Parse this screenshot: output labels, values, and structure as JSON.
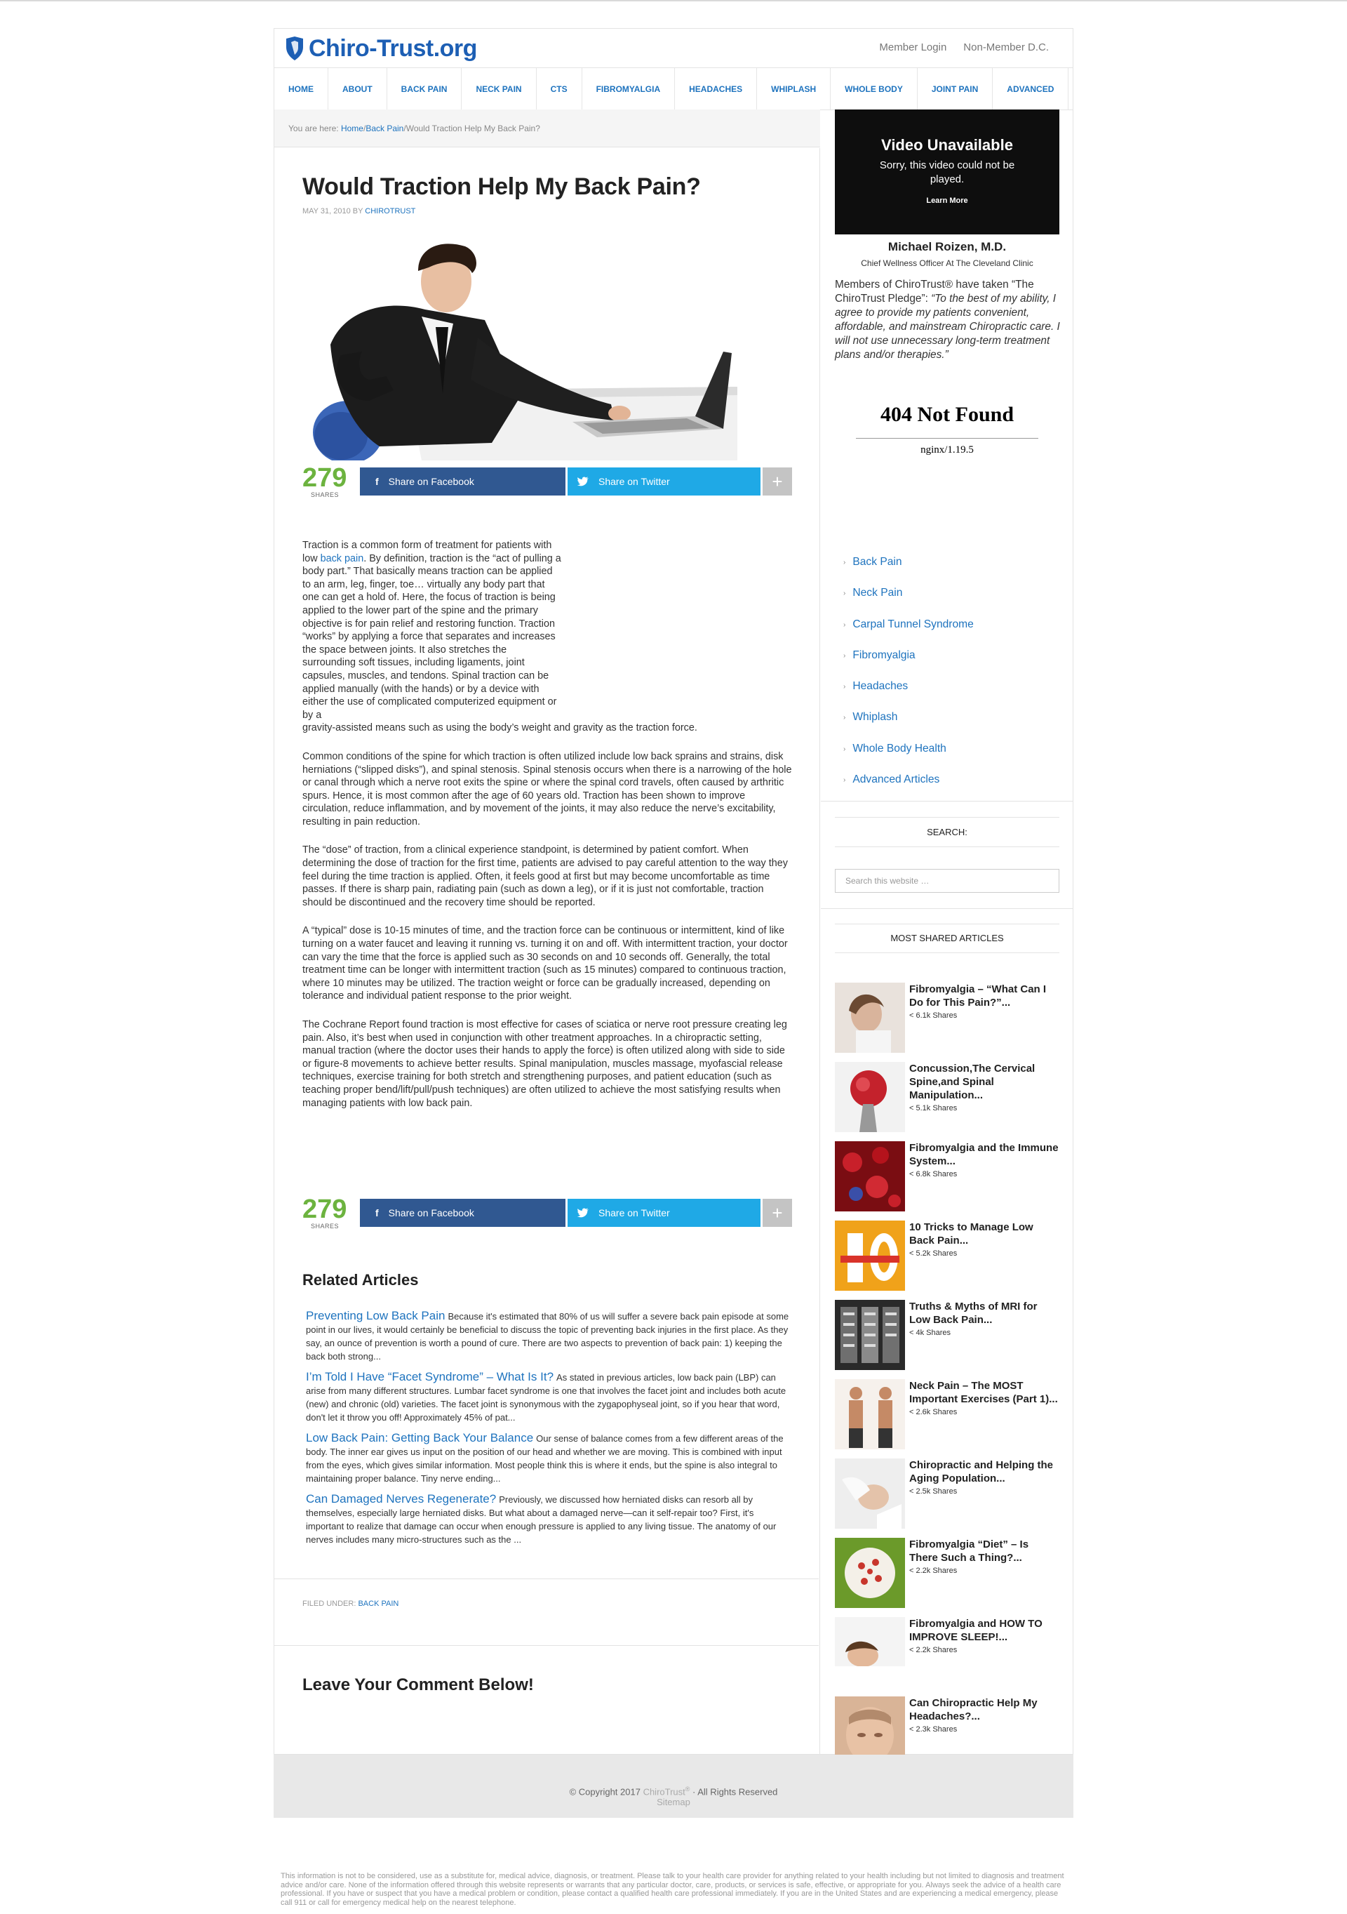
{
  "site": {
    "logo_text": "Chiro-Trust.org",
    "header_links": [
      "Member Login",
      "Non-Member D.C."
    ],
    "nav": [
      "HOME",
      "ABOUT",
      "BACK PAIN",
      "NECK PAIN",
      "CTS",
      "FIBROMYALGIA",
      "HEADACHES",
      "WHIPLASH",
      "WHOLE BODY",
      "JOINT PAIN",
      "ADVANCED"
    ]
  },
  "breadcrumb": {
    "prefix": "You are here: ",
    "home": "Home",
    "sep1": " / ",
    "section": "Back Pain",
    "sep2": " / ",
    "current": "Would Traction Help My Back Pain?"
  },
  "article": {
    "title": "Would Traction Help My Back Pain?",
    "date": "MAY 31, 2010",
    "by": " BY ",
    "author": "CHIROTRUST",
    "share_count": "279",
    "share_label": "SHARES",
    "share_facebook": "Share on Facebook",
    "share_twitter": "Share on Twitter",
    "share_more": "+",
    "p1_before": "Traction is a common form of treatment for patients with low ",
    "p1_link": "back pain",
    "p1_after": ". By definition, traction is the “act of pulling a body part.” That basically means traction can be applied to an arm, leg, finger, toe… virtually any body part that one can get a hold of. Here, the focus of traction is being applied to the lower part of the spine and the primary objective is for pain relief and restoring function. Traction “works” by applying a force that separates and increases the space between joints. It also stretches the surrounding soft tissues, including ligaments, joint capsules, muscles, and tendons. Spinal traction can be applied manually (with the hands) or by a device with either the use of complicated computerized equipment or by a",
    "p1_tail": "gravity-assisted means such as using the body’s weight and gravity as the traction force.",
    "p2": "Common conditions of the spine for which traction is often utilized include low back sprains and strains, disk herniations (“slipped disks”), and spinal stenosis. Spinal stenosis occurs when there is a narrowing of the hole or canal through which a nerve root exits the spine or where the spinal cord travels, often caused by arthritic spurs. Hence, it is most common after the age of 60 years old. Traction has been shown to improve circulation, reduce inflammation, and by movement of the joints, it may also reduce the nerve’s excitability, resulting in pain reduction.",
    "p3": "The “dose” of traction, from a clinical experience standpoint, is determined by patient comfort. When determining the dose of traction for the first time, patients are advised to pay careful attention to the way they feel during the time traction is applied. Often, it feels good at first but may become uncomfortable as time passes. If there is sharp pain, radiating pain (such as down a leg), or if it is just not comfortable, traction should be discontinued and the recovery time should be reported.",
    "p4": "A “typical” dose is 10-15 minutes of time, and the traction force can be continuous or intermittent, kind of like turning on a water faucet and leaving it running vs. turning it on and off. With intermittent traction, your doctor can vary the time that the force is applied such as 30 seconds on and 10 seconds off. Generally, the total treatment time can be longer with intermittent traction (such as 15 minutes) compared to continuous traction, where 10 minutes may be utilized. The traction weight or force can be gradually increased, depending on tolerance and individual patient response to the prior weight.",
    "p5": "The Cochrane Report found traction is most effective for cases of sciatica or nerve root pressure creating leg pain. Also, it’s best when used in conjunction with other treatment approaches. In a chiropractic setting, manual traction (where the doctor uses their hands to apply the force) is often utilized along with side to side or figure-8 movements to achieve better results. Spinal manipulation, muscles massage, myofascial release techniques, exercise training for both stretch and strengthening purposes, and patient education (such as teaching proper bend/lift/pull/push techniques) are often utilized to achieve the most satisfying results when managing patients with low back pain.",
    "related_title": "Related Articles",
    "related": [
      {
        "title": "Preventing Low Back Pain",
        "excerpt": "Because it's estimated that 80% of us will suffer a severe back pain episode at some point in our lives, it would certainly be beneficial to discuss the topic of preventing back injuries in the first place. As they say, an ounce of prevention is worth a pound of cure. There are two aspects to prevention of back pain: 1) keeping the back both strong..."
      },
      {
        "title": "I’m Told I Have “Facet Syndrome” – What Is It?",
        "excerpt": "As stated in previous articles, low back pain (LBP) can arise from many different structures. Lumbar facet syndrome is one that involves the facet joint and includes both acute (new) and chronic (old) varieties. The facet joint is synonymous with the zygapophyseal joint, so if you hear that word, don't let it throw you off! Approximately 45% of pat..."
      },
      {
        "title": "Low Back Pain: Getting Back Your Balance",
        "excerpt": "Our sense of balance comes from a few different areas of the body. The inner ear gives us input on the position of our head and whether we are moving. This is combined with input from the eyes, which gives similar information. Most people think this is where it ends, but the spine is also integral to maintaining proper balance. Tiny nerve ending..."
      },
      {
        "title": "Can Damaged Nerves Regenerate?",
        "excerpt": "Previously, we discussed how herniated disks can resorb all by themselves, especially large herniated disks. But what about a damaged nerve—can it self-repair too? First, it's important to realize that damage can occur when enough pressure is applied to any living tissue. The anatomy of our nerves includes many micro-structures such as the ..."
      }
    ],
    "filed_label": "FILED UNDER: ",
    "filed_cat": "BACK PAIN",
    "comment_title": "Leave Your Comment Below!"
  },
  "sidebar": {
    "video_title": "Video Unavailable",
    "video_msg": "Sorry, this video could not be played.",
    "video_link": "Learn More",
    "doc_name": "Michael Roizen, M.D.",
    "doc_title": "Chief Wellness Officer At The Cleveland Clinic",
    "pledge_intro": "Members of ChiroTrust® have taken “The ChiroTrust Pledge”: ",
    "pledge_quote": "“To the best of my ability, I agree to provide my patients convenient, affordable, and mainstream Chiropractic care. I will not use unnecessary long-term treatment plans and/or therapies.”",
    "nf_title": "404 Not Found",
    "nf_server": "nginx/1.19.5",
    "categories": [
      "Back Pain",
      "Neck Pain",
      "Carpal Tunnel Syndrome",
      "Fibromyalgia",
      "Headaches",
      "Whiplash",
      "Whole Body Health",
      "Advanced Articles"
    ],
    "search_title": "SEARCH:",
    "search_placeholder": "Search this website …",
    "most_shared_title": "MOST SHARED ARTICLES",
    "most_shared": [
      {
        "title": "Fibromyalgia – “What Can I Do for This Pain?”...",
        "count": "6.1k Shares"
      },
      {
        "title": "Concussion,The Cervical Spine,and Spinal Manipulation...",
        "count": "5.1k Shares"
      },
      {
        "title": "Fibromyalgia and the Immune System...",
        "count": "6.8k Shares"
      },
      {
        "title": "10 Tricks to Manage Low Back Pain...",
        "count": "5.2k Shares"
      },
      {
        "title": "Truths & Myths of MRI for Low Back Pain...",
        "count": "4k Shares"
      },
      {
        "title": "Neck Pain – The MOST Important Exercises (Part 1)...",
        "count": "2.6k Shares"
      },
      {
        "title": "Chiropractic and Helping the Aging Population...",
        "count": "2.5k Shares"
      },
      {
        "title": "Fibromyalgia “Diet” – Is There Such a Thing?...",
        "count": "2.2k Shares"
      },
      {
        "title": "Fibromyalgia and HOW TO IMPROVE SLEEP!...",
        "count": "2.2k Shares"
      },
      {
        "title": "Can Chiropractic Help My Headaches?...",
        "count": "2.3k Shares"
      }
    ]
  },
  "footer": {
    "copyright_before": "© Copyright 2017 ",
    "brand": "ChiroTrust",
    "reg": "®",
    "copyright_after": " · All Rights Reserved",
    "sitemap": "Sitemap",
    "disclaimer": "This information is not to be considered, use as a substitute for, medical advice, diagnosis, or treatment. Please talk to your health care provider for anything related to your health including but not limited to diagnosis and treatment advice and/or care. None of the information offered through this website represents or warrants that any particular doctor, care, products, or services is safe, effective, or appropriate for you. Always seek the advice of a health care professional. If you have or suspect that you have a medical problem or condition, please contact a qualified health care professional immediately. If you are in the United States and are experiencing a medical emergency, please call 911 or call for emergency medical help on the nearest telephone."
  },
  "colors": {
    "brand": "#1d5fb4",
    "link": "#1e73be",
    "share_count": "#6cb33f",
    "facebook": "#305891",
    "twitter": "#1fa9e6"
  }
}
